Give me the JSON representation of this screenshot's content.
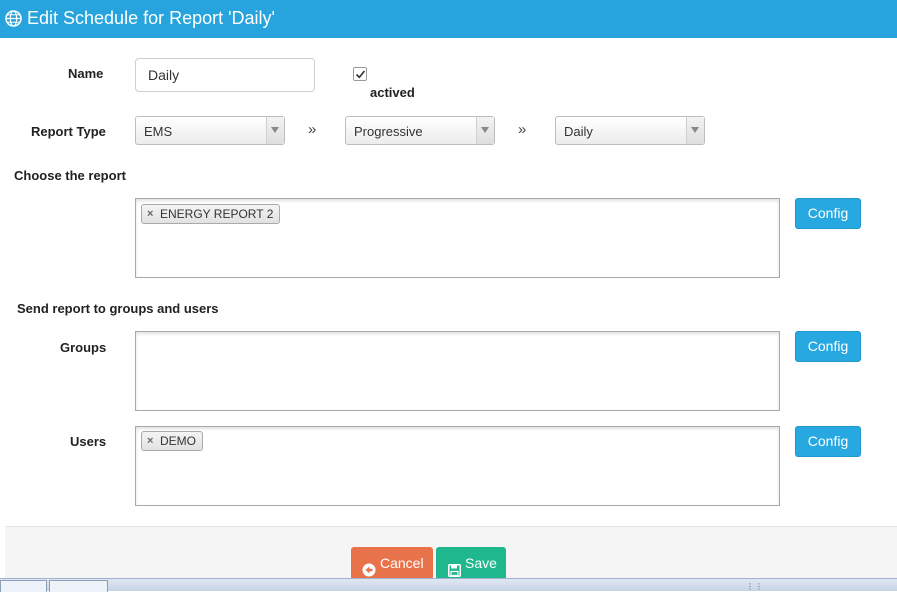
{
  "dialog": {
    "title": "Edit Schedule for Report 'Daily'"
  },
  "form": {
    "name_label": "Name",
    "name_value": "Daily",
    "actived_label": "actived",
    "actived_checked": true,
    "report_type_label": "Report Type",
    "report_type_selects": [
      "EMS",
      "Progressive",
      "Daily"
    ],
    "separator_glyph": "»",
    "choose_report_label": "Choose the report",
    "report_tags": [
      "ENERGY REPORT 2"
    ],
    "send_to_label": "Send report to groups and users",
    "groups_label": "Groups",
    "group_tags": [],
    "users_label": "Users",
    "user_tags": [
      "DEMO"
    ],
    "config_label": "Config",
    "tag_remove_glyph": "×"
  },
  "footer": {
    "cancel_label": "Cancel",
    "save_label": "Save"
  },
  "colors": {
    "titlebar": "#27a4dd",
    "config_button": "#28a8e0",
    "cancel_button": "#e8734a",
    "save_button": "#1fb88e"
  },
  "icons": {
    "title": "globe-icon",
    "cancel": "arrow-circle-left-icon",
    "save": "floppy-disk-icon",
    "check": "checkmark-icon",
    "separator": "double-chevron-right-icon",
    "dropdown": "caret-down-icon",
    "remove_tag": "close-icon"
  }
}
